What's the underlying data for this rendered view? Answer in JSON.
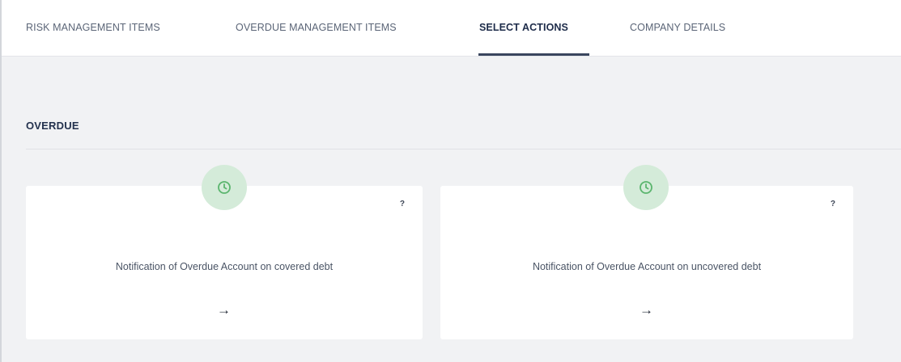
{
  "tabs": [
    {
      "label": "RISK MANAGEMENT ITEMS",
      "active": false
    },
    {
      "label": "OVERDUE MANAGEMENT ITEMS",
      "active": false
    },
    {
      "label": "SELECT ACTIONS",
      "active": true
    },
    {
      "label": "COMPANY DETAILS",
      "active": false
    }
  ],
  "section": {
    "title": "OVERDUE"
  },
  "cards": [
    {
      "icon": "clock-icon",
      "help": "?",
      "title": "Notification of Overdue Account on covered debt",
      "action_icon": "arrow-right-icon",
      "action": "→"
    },
    {
      "icon": "clock-icon",
      "help": "?",
      "title": "Notification of Overdue Account on uncovered debt",
      "action_icon": "arrow-right-icon",
      "action": "→"
    }
  ],
  "colors": {
    "accent_green": "#d4ebd9",
    "icon_green": "#5bb56e",
    "active_tab": "#1e2c4a",
    "background": "#f1f2f4"
  }
}
